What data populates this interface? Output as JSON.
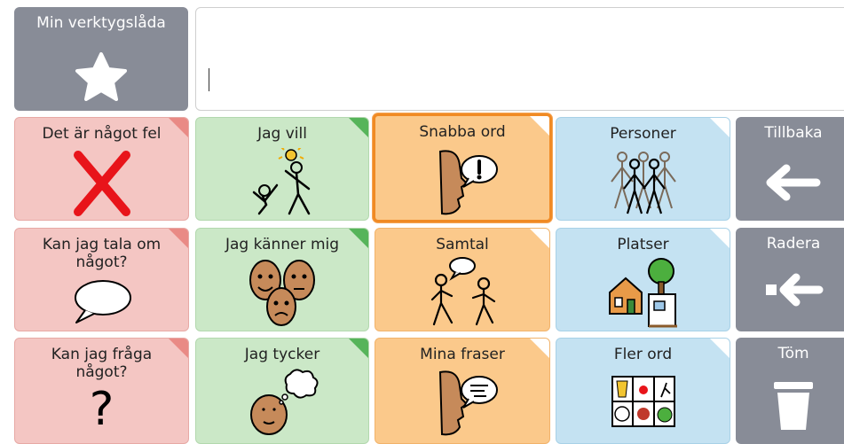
{
  "toolbox": {
    "label": "Min verktygslåda"
  },
  "message_bar": {
    "text": ""
  },
  "grid": {
    "row1": {
      "c1": "Det är något fel",
      "c2": "Jag vill",
      "c3": "Snabba ord",
      "c4": "Personer",
      "c5": "Tillbaka"
    },
    "row2": {
      "c1": "Kan jag tala om något?",
      "c2": "Jag känner mig",
      "c3": "Samtal",
      "c4": "Platser",
      "c5": "Radera"
    },
    "row3": {
      "c1": "Kan jag fråga något?",
      "c2": "Jag tycker",
      "c3": "Mina fraser",
      "c4": "Fler ord",
      "c5": "Töm"
    }
  },
  "icons": {
    "toolbox": "star-icon",
    "r1c1": "red-x-icon",
    "r1c2": "want-figures-icon",
    "r1c3": "quick-words-speech-icon",
    "r1c4": "people-group-icon",
    "r1c5": "back-arrow-icon",
    "r2c1": "speech-bubble-icon",
    "r2c2": "feeling-faces-icon",
    "r2c3": "conversation-icon",
    "r2c4": "places-house-tree-icon",
    "r2c5": "delete-arrow-icon",
    "r3c1": "question-mark-icon",
    "r3c2": "thinking-face-icon",
    "r3c3": "phrases-speech-icon",
    "r3c4": "more-words-grid-icon",
    "r3c5": "trash-icon"
  },
  "colors": {
    "red": "#f4c6c3",
    "green": "#cbe8c7",
    "orange": "#fbc98b",
    "blue": "#c4e2f2",
    "grey": "#888c97",
    "selected_border": "#f08a24"
  },
  "selected_cell": "Snabba ord"
}
